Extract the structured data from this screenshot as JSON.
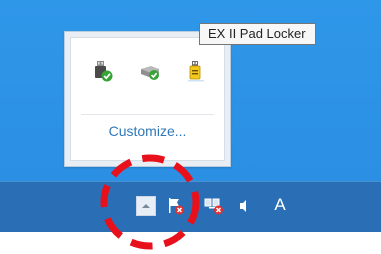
{
  "tooltip": {
    "text": "EX II Pad Locker"
  },
  "flyout": {
    "customize_label": "Customize...",
    "icons": [
      "usb-device-icon",
      "network-check-icon",
      "pad-locker-icon"
    ]
  },
  "taskbar": {
    "ime_label": "A",
    "tray_icons": [
      "show-hidden-icons-chevron",
      "action-center-flag-icon",
      "network-error-icon",
      "speaker-icon",
      "ime-indicator"
    ]
  },
  "colors": {
    "desktop": "#2f97e8",
    "taskbar": "#2a6fb5",
    "link": "#2f78b8",
    "highlight": "#e8101a"
  }
}
